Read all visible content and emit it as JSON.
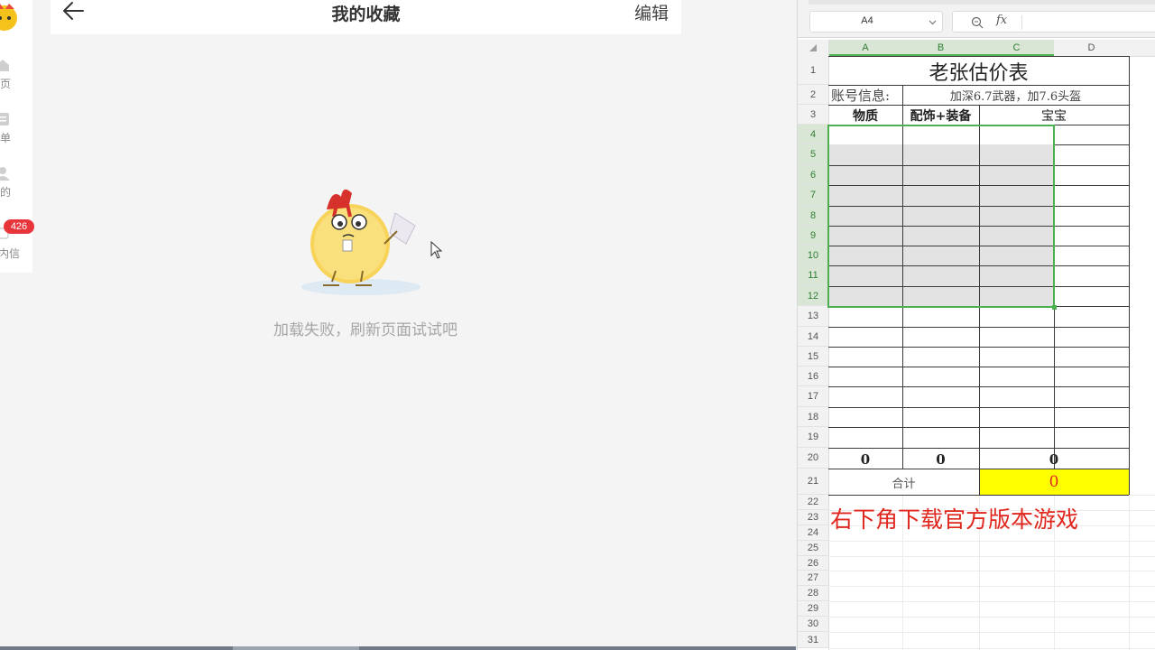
{
  "app": {
    "title": "我的收藏",
    "edit_label": "编辑",
    "empty_message": "加载失败，刷新页面试试吧",
    "nav": [
      {
        "label": "首页",
        "icon": "home-icon"
      },
      {
        "label": "订单",
        "icon": "order-icon"
      },
      {
        "label": "我的",
        "icon": "user-icon"
      },
      {
        "label": "站内信",
        "icon": "mail-icon"
      }
    ],
    "nav_visible_labels": [
      "页",
      "单",
      "的",
      "内信"
    ],
    "unread_badge": "426"
  },
  "sheet": {
    "name_box": "A4",
    "fx_label": "fx",
    "columns": [
      "A",
      "B",
      "C",
      "D"
    ],
    "rows": [
      "1",
      "2",
      "3",
      "4",
      "5",
      "6",
      "7",
      "8",
      "9",
      "10",
      "11",
      "12",
      "13",
      "14",
      "15",
      "16",
      "17",
      "18",
      "19",
      "20",
      "21",
      "22",
      "23",
      "24",
      "25",
      "26",
      "27",
      "28",
      "29",
      "30",
      "31"
    ],
    "title": "老张估价表",
    "account_label": "账号信息:",
    "account_value": "加深6.7武器，加7.6头盔",
    "header_wuzhi": "物质",
    "header_peishi": "配饰+装备",
    "header_baobao": "宝宝",
    "sum_a": "0",
    "sum_b": "0",
    "sum_c": "0",
    "total_label": "合计",
    "total_value": "0",
    "note": "右下角下载官方版本游戏",
    "accent_color": "#4caf50",
    "note_color": "#e0271e",
    "total_fill": "#ffff00"
  }
}
